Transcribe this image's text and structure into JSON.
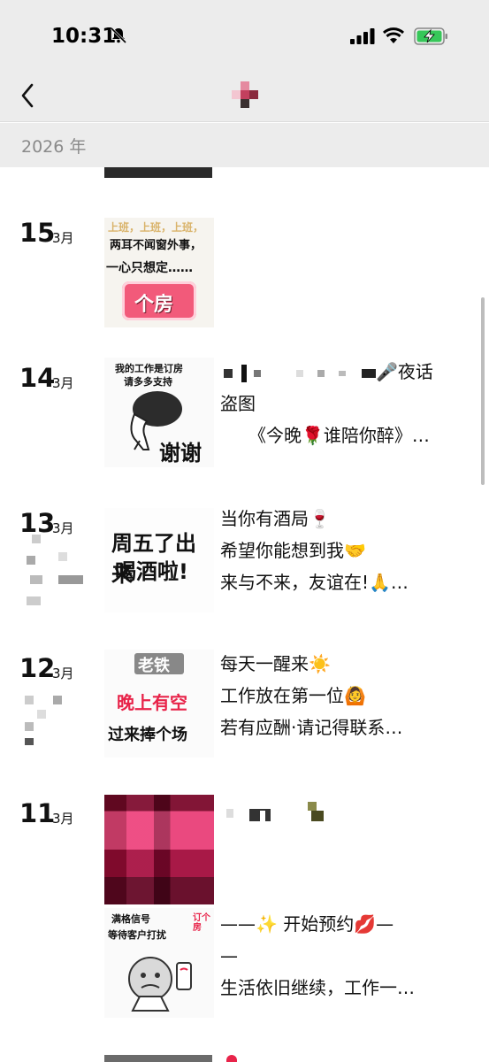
{
  "status": {
    "time": "10:31"
  },
  "year_header": "2026 年",
  "entries": [
    {
      "day": "15",
      "month": "3月",
      "thumb": {
        "line1": "上班，上班，上班，",
        "line2": "两耳不闻窗外事，",
        "line3": "一心只想定……",
        "badge": "个房"
      }
    },
    {
      "day": "14",
      "month": "3月",
      "thumb": {
        "line1": "我的工作是订房",
        "line2": "请多多支持",
        "footer": "谢谢"
      },
      "caption": [
        "🎤夜话",
        "盗图",
        "《今晚🌹谁陪你醉》…"
      ]
    },
    {
      "day": "13",
      "month": "3月",
      "thumb": {
        "line1": "周五了出来",
        "line2": "喝酒啦!"
      },
      "caption": [
        "当你有酒局🍷",
        "希望你能想到我🤝",
        "来与不来，友谊在!🙏…"
      ]
    },
    {
      "day": "12",
      "month": "3月",
      "thumb": {
        "line1": "老铁",
        "line2": "晚上有空",
        "line3": "过来捧个场"
      },
      "caption": [
        "每天一醒来☀️",
        "工作放在第一位🙆",
        "若有应酬·请记得联系…"
      ]
    },
    {
      "day": "11",
      "month": "3月",
      "thumb2": {
        "line1": "满格信号",
        "line2": "等待客户打扰",
        "tag": "订个房"
      },
      "caption": [
        "——✨ 开始预约💋—",
        "—",
        "生活依旧继续，工作一…"
      ]
    }
  ],
  "colors": {
    "accent_red": "#e8244a",
    "navbar_bg": "#ececec",
    "battery_green": "#36c759"
  }
}
